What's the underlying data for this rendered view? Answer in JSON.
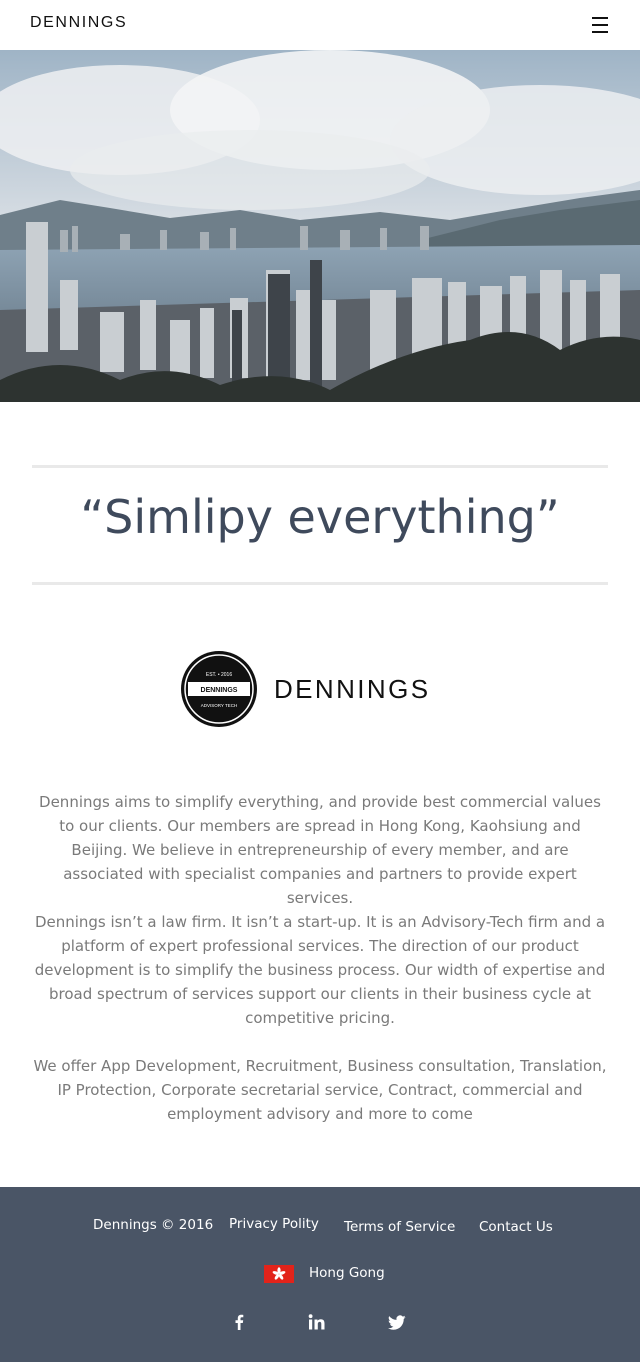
{
  "header": {
    "brand": "DENNINGS"
  },
  "quote": "“Simlipy everything”",
  "logo": {
    "wordmark": "DENNINGS",
    "badge_top": "EST. • 2016",
    "badge_middle": "DENNINGS",
    "badge_bottom": "ADVISORY TECH"
  },
  "paragraphs": [
    "Dennings aims to simplify everything, and provide best commercial values to our clients. Our members are spread in Hong Kong, Kaohsiung and Beijing. We believe in entrepreneurship of every member, and are associated with specialist companies and partners to provide expert services.",
    "Dennings isn’t a law firm. It isn’t a start-up. It is an Advisory-Tech firm and a platform of expert professional services. The direction of our product development is to simplify the business process. Our width of expertise and broad spectrum of services support our clients in their business cycle at competitive pricing.",
    "We offer App Development, Recruitment, Business consultation, Translation, IP Protection, Corporate secretarial service, Contract, commercial and employment advisory and more to come"
  ],
  "footer": {
    "copyright": "Dennings © 2016",
    "links": {
      "privacy": "Privacy Polity",
      "terms": "Terms of Service",
      "contact": "Contact Us"
    },
    "region": "Hong Gong",
    "social_icons": [
      "facebook-icon",
      "linkedin-icon",
      "twitter-icon"
    ]
  },
  "colors": {
    "footer_bg": "#4a5566",
    "quote_text": "#3f4a5c",
    "body_text": "#7a7a7a",
    "flag_red": "#e2231a"
  }
}
